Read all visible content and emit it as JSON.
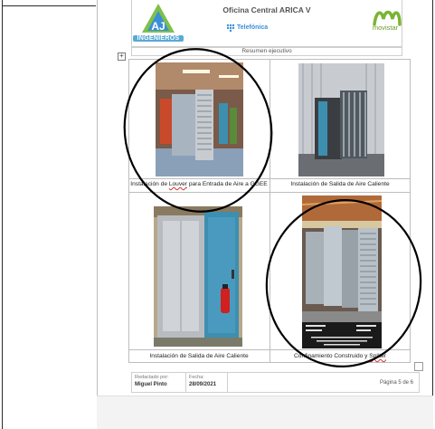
{
  "header": {
    "company_logo_text": "INGENIEROS",
    "company_logo_mark": "AJ",
    "title": "Oficina Central ARICA V",
    "operator": "Telefónica",
    "brand": "movistar",
    "subtitle": "Resumen ejecutivo"
  },
  "photos": [
    {
      "caption_pre": "Instalación de ",
      "caption_err": "Louver",
      "caption_post": " para Entrada de Aire a GGEE"
    },
    {
      "caption_pre": "Instalación de Salida de Aire Caliente",
      "caption_err": "",
      "caption_post": ""
    },
    {
      "caption_pre": "Instalación de Salida de Aire Caliente",
      "caption_err": "",
      "caption_post": ""
    },
    {
      "caption_pre": "Confinamiento Construido y ",
      "caption_err": "Spliter",
      "caption_post": ""
    }
  ],
  "footer": {
    "author_label": "Redactado por:",
    "author": "Miguel Pinto",
    "date_label": "Fecha:",
    "date": "28/09/2021",
    "page": "Página 5 de 6"
  },
  "colors": {
    "annotation_circle": "#000000",
    "telefonica_blue": "#3a8fd8",
    "movistar_green": "#6a9a2a",
    "spellcheck_red": "#d03030"
  }
}
